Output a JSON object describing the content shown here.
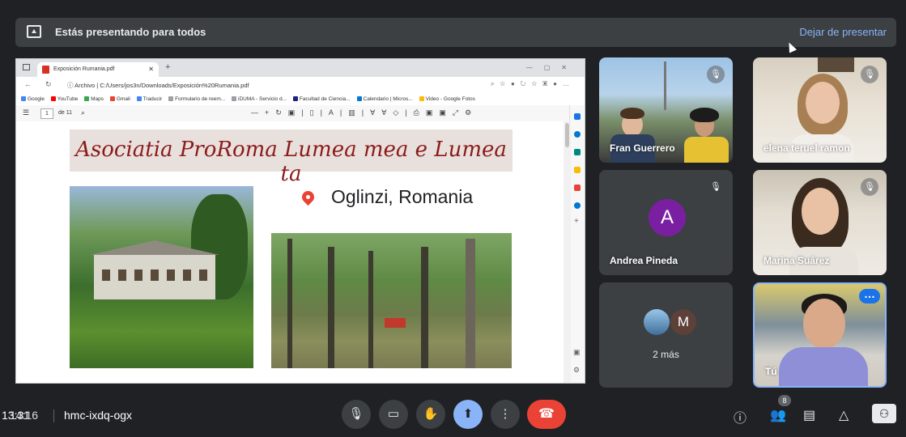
{
  "banner": {
    "message": "Estás presentando para todos",
    "stop_label": "Dejar de presentar"
  },
  "browser": {
    "tab_title": "Exposición Rumania.pdf",
    "new_tab": "+",
    "address_prefix": "ⓘ Archivo",
    "address": "C:/Users/jos3n/Downloads/Exposición%20Rumania.pdf",
    "bookmarks": [
      "Google",
      "YouTube",
      "Maps",
      "Gmail",
      "Traducir",
      "Formulario de reem...",
      "iDUMA - Servicio d...",
      "Facultad de Ciencia...",
      "Calendario | Micros...",
      "Video - Google Fotos"
    ],
    "page_current": "1",
    "page_total": "de 11"
  },
  "slide": {
    "banner_text": "Asociatia ProRoma   Lumea mea e Lumea ta",
    "location": "Oglinzi, Romania"
  },
  "participants": [
    {
      "name": "Fran Guerrero"
    },
    {
      "name": "elena teruel ramon"
    },
    {
      "name": "Andrea Pineda",
      "initial": "A"
    },
    {
      "name": "Marina Suárez"
    },
    {
      "more_initial": "M",
      "more_label": "2 más"
    },
    {
      "name": "Tú"
    }
  ],
  "footer": {
    "time": "13:31",
    "time_overlap": "14:16",
    "meeting_code": "hmc-ixdq-ogx",
    "people_count": "8"
  },
  "colors": {
    "background": "#202124",
    "accent": "#8ab4f8",
    "end_call": "#ea4335",
    "avatar_a": "#7b1fa2"
  }
}
